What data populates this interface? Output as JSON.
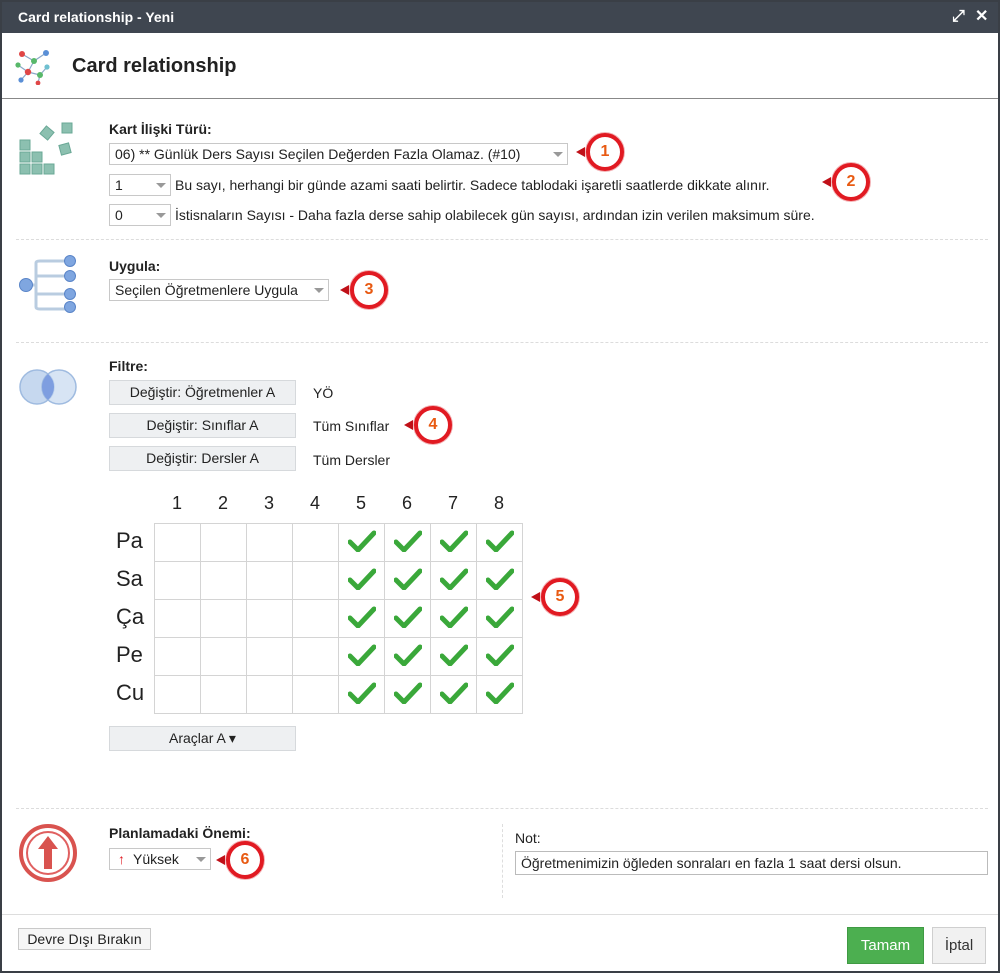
{
  "window": {
    "title": "Card relationship - Yeni"
  },
  "header": {
    "title": "Card relationship"
  },
  "relation_type": {
    "label": "Kart İlişki Türü:",
    "selected": "06) ** Günlük Ders Sayısı Seçilen Değerden Fazla Olamaz. (#10)",
    "count_value": "1",
    "count_desc": "Bu sayı, herhangi bir günde azami saati belirtir. Sadece tablodaki işaretli saatlerde dikkate alınır.",
    "exceptions_value": "0",
    "exceptions_desc": "İstisnaların Sayısı - Daha fazla derse sahip olabilecek gün sayısı, ardından izin verilen maksimum süre."
  },
  "apply": {
    "label": "Uygula:",
    "selected": "Seçilen Öğretmenlere Uygula"
  },
  "filter": {
    "label": "Filtre:",
    "teachers_button": "Değiştir: Öğretmenler A",
    "teachers_value": "YÖ",
    "classes_button": "Değiştir: Sınıflar A",
    "classes_value": "Tüm Sınıflar",
    "subjects_button": "Değiştir: Dersler A",
    "subjects_value": "Tüm Dersler"
  },
  "grid": {
    "columns": [
      "1",
      "2",
      "3",
      "4",
      "5",
      "6",
      "7",
      "8"
    ],
    "rows": [
      "Pa",
      "Sa",
      "Ça",
      "Pe",
      "Cu"
    ],
    "checked": [
      [
        false,
        false,
        false,
        false,
        true,
        true,
        true,
        true
      ],
      [
        false,
        false,
        false,
        false,
        true,
        true,
        true,
        true
      ],
      [
        false,
        false,
        false,
        false,
        true,
        true,
        true,
        true
      ],
      [
        false,
        false,
        false,
        false,
        true,
        true,
        true,
        true
      ],
      [
        false,
        false,
        false,
        false,
        true,
        true,
        true,
        true
      ]
    ],
    "check_color": "#3aa83a"
  },
  "tools_button": "Araçlar A ▾",
  "importance": {
    "label": "Planlamadaki Önemi:",
    "selected": "Yüksek",
    "arrow_color": "#e11a22"
  },
  "note": {
    "label": "Not:",
    "value": "Öğretmenimizin öğleden sonraları en fazla 1 saat dersi olsun."
  },
  "footer": {
    "disable_button": "Devre Dışı Bırakın",
    "ok_button": "Tamam",
    "cancel_button": "İptal"
  },
  "badges": [
    "1",
    "2",
    "3",
    "4",
    "5",
    "6"
  ],
  "colors": {
    "titlebar": "#3f4650",
    "badge_ring": "#e11a22",
    "badge_text": "#e85a12",
    "ok": "#4caf50"
  }
}
